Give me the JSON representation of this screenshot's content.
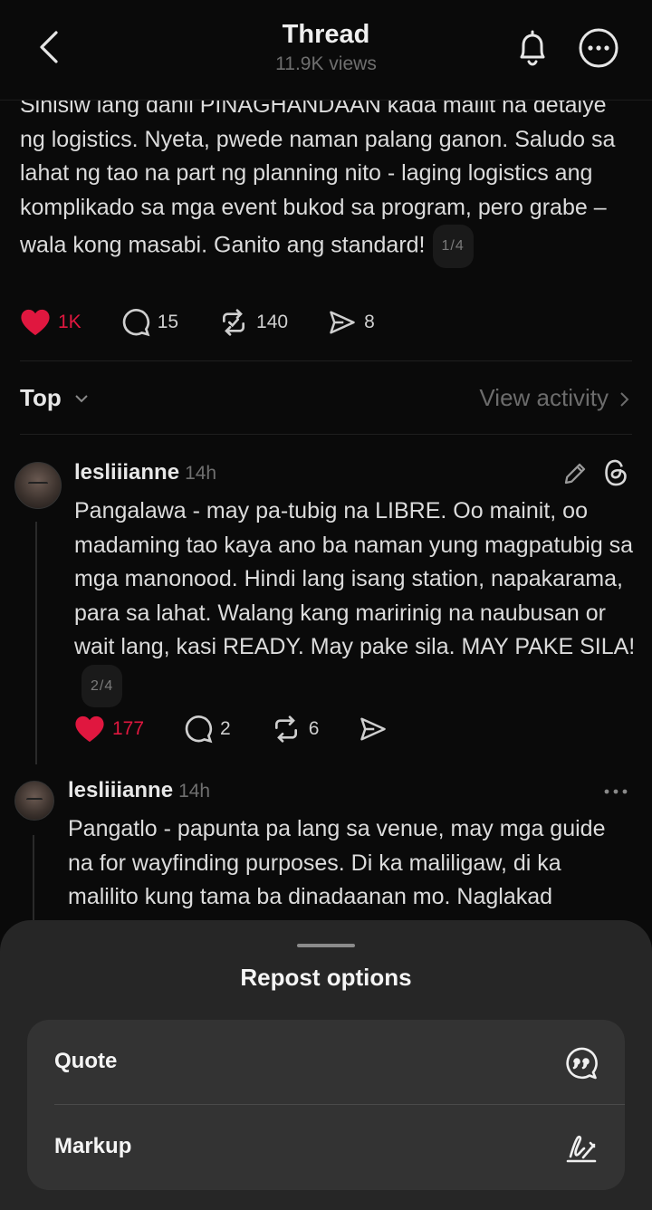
{
  "header": {
    "title": "Thread",
    "views": "11.9K views"
  },
  "post": {
    "text": "Sinisiw lang danil PINAGHANDAAN kada maliit na detalye ng logistics. Nyeta, pwede naman palang ganon. Saludo sa lahat ng tao na part ng planning nito - laging logistics ang komplikado sa mga event bukod sa program, pero grabe – wala kong masabi. Ganito ang standard!",
    "pager": "1/4",
    "likes": "1K",
    "comments": "15",
    "reposts": "140",
    "shares": "8"
  },
  "sort": {
    "label": "Top",
    "view_activity": "View activity"
  },
  "replies": [
    {
      "username": "lesliiianne",
      "time": "14h",
      "text": "Pangalawa - may pa-tubig na LIBRE. Oo mainit, oo madaming tao kaya ano ba naman yung magpatubig sa mga manonood. Hindi lang isang station, napakarama, para sa lahat. Walang kang maririnig na naubusan or wait lang, kasi READY. May pake sila. MAY PAKE SILA!",
      "pager": "2/4",
      "likes": "177",
      "comments": "2",
      "reposts": "6"
    },
    {
      "username": "lesliiianne",
      "time": "14h",
      "text": "Pangatlo - papunta pa lang sa venue, may mga guide na for wayfinding purposes. Di ka maliligaw, di ka malilito kung tama ba dinadaanan mo. Naglakad"
    }
  ],
  "sheet": {
    "title": "Repost options",
    "options": [
      {
        "label": "Quote",
        "icon": "quote-icon"
      },
      {
        "label": "Markup",
        "icon": "markup-icon"
      }
    ]
  },
  "colors": {
    "background": "#000000",
    "like": "#e0173f",
    "sheet": "#262626",
    "card": "#333333"
  }
}
